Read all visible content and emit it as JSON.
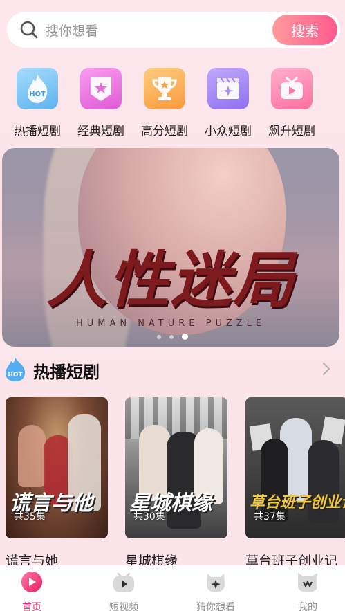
{
  "search": {
    "placeholder": "搜你想看",
    "button": "搜索"
  },
  "categories": [
    {
      "label": "热播短剧",
      "icon": "hot-flame-icon",
      "color": "#7fc6f4"
    },
    {
      "label": "经典短剧",
      "icon": "star-badge-icon",
      "color": "#f27be6"
    },
    {
      "label": "高分短剧",
      "icon": "trophy-icon",
      "color": "#fbb45b"
    },
    {
      "label": "小众短剧",
      "icon": "clapperboard-icon",
      "color": "#a58cf5"
    },
    {
      "label": "飙升短剧",
      "icon": "tv-play-icon",
      "color": "#ff8fb4"
    }
  ],
  "banner": {
    "title": "人性迷局",
    "subtitle": "HUMAN NATURE PUZZLE",
    "dots": 3,
    "active_dot": 3
  },
  "section": {
    "title": "热播短剧",
    "icon": "hot-flame-icon"
  },
  "dramas": [
    {
      "name": "谎言与她",
      "poster_title": "谎言与他",
      "episodes": "共35集",
      "bg": "#5a3a2c"
    },
    {
      "name": "星城棋缘",
      "poster_title": "星城棋缘",
      "episodes": "共30集",
      "bg": "#3b3b3d"
    },
    {
      "name": "草台班子创业记",
      "poster_title": "草台班子创业记",
      "episodes": "共37集",
      "bg": "#4a4a4a"
    }
  ],
  "nav": [
    {
      "label": "首页",
      "icon": "home-play-icon",
      "active": true
    },
    {
      "label": "短视频",
      "icon": "short-video-icon",
      "active": false
    },
    {
      "label": "猜你想看",
      "icon": "guess-like-icon",
      "active": false
    },
    {
      "label": "我的",
      "icon": "profile-icon",
      "active": false
    }
  ],
  "colors": {
    "accent": "#ee2f6f",
    "search_button_from": "#ff9a9c",
    "search_button_to": "#ff5a8e"
  }
}
